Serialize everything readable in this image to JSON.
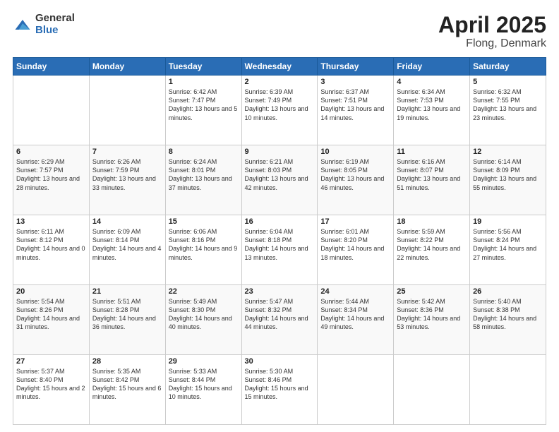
{
  "header": {
    "logo_general": "General",
    "logo_blue": "Blue",
    "title": "April 2025",
    "subtitle": "Flong, Denmark"
  },
  "days_of_week": [
    "Sunday",
    "Monday",
    "Tuesday",
    "Wednesday",
    "Thursday",
    "Friday",
    "Saturday"
  ],
  "weeks": [
    [
      {
        "day": "",
        "info": ""
      },
      {
        "day": "",
        "info": ""
      },
      {
        "day": "1",
        "info": "Sunrise: 6:42 AM\nSunset: 7:47 PM\nDaylight: 13 hours and 5 minutes."
      },
      {
        "day": "2",
        "info": "Sunrise: 6:39 AM\nSunset: 7:49 PM\nDaylight: 13 hours and 10 minutes."
      },
      {
        "day": "3",
        "info": "Sunrise: 6:37 AM\nSunset: 7:51 PM\nDaylight: 13 hours and 14 minutes."
      },
      {
        "day": "4",
        "info": "Sunrise: 6:34 AM\nSunset: 7:53 PM\nDaylight: 13 hours and 19 minutes."
      },
      {
        "day": "5",
        "info": "Sunrise: 6:32 AM\nSunset: 7:55 PM\nDaylight: 13 hours and 23 minutes."
      }
    ],
    [
      {
        "day": "6",
        "info": "Sunrise: 6:29 AM\nSunset: 7:57 PM\nDaylight: 13 hours and 28 minutes."
      },
      {
        "day": "7",
        "info": "Sunrise: 6:26 AM\nSunset: 7:59 PM\nDaylight: 13 hours and 33 minutes."
      },
      {
        "day": "8",
        "info": "Sunrise: 6:24 AM\nSunset: 8:01 PM\nDaylight: 13 hours and 37 minutes."
      },
      {
        "day": "9",
        "info": "Sunrise: 6:21 AM\nSunset: 8:03 PM\nDaylight: 13 hours and 42 minutes."
      },
      {
        "day": "10",
        "info": "Sunrise: 6:19 AM\nSunset: 8:05 PM\nDaylight: 13 hours and 46 minutes."
      },
      {
        "day": "11",
        "info": "Sunrise: 6:16 AM\nSunset: 8:07 PM\nDaylight: 13 hours and 51 minutes."
      },
      {
        "day": "12",
        "info": "Sunrise: 6:14 AM\nSunset: 8:09 PM\nDaylight: 13 hours and 55 minutes."
      }
    ],
    [
      {
        "day": "13",
        "info": "Sunrise: 6:11 AM\nSunset: 8:12 PM\nDaylight: 14 hours and 0 minutes."
      },
      {
        "day": "14",
        "info": "Sunrise: 6:09 AM\nSunset: 8:14 PM\nDaylight: 14 hours and 4 minutes."
      },
      {
        "day": "15",
        "info": "Sunrise: 6:06 AM\nSunset: 8:16 PM\nDaylight: 14 hours and 9 minutes."
      },
      {
        "day": "16",
        "info": "Sunrise: 6:04 AM\nSunset: 8:18 PM\nDaylight: 14 hours and 13 minutes."
      },
      {
        "day": "17",
        "info": "Sunrise: 6:01 AM\nSunset: 8:20 PM\nDaylight: 14 hours and 18 minutes."
      },
      {
        "day": "18",
        "info": "Sunrise: 5:59 AM\nSunset: 8:22 PM\nDaylight: 14 hours and 22 minutes."
      },
      {
        "day": "19",
        "info": "Sunrise: 5:56 AM\nSunset: 8:24 PM\nDaylight: 14 hours and 27 minutes."
      }
    ],
    [
      {
        "day": "20",
        "info": "Sunrise: 5:54 AM\nSunset: 8:26 PM\nDaylight: 14 hours and 31 minutes."
      },
      {
        "day": "21",
        "info": "Sunrise: 5:51 AM\nSunset: 8:28 PM\nDaylight: 14 hours and 36 minutes."
      },
      {
        "day": "22",
        "info": "Sunrise: 5:49 AM\nSunset: 8:30 PM\nDaylight: 14 hours and 40 minutes."
      },
      {
        "day": "23",
        "info": "Sunrise: 5:47 AM\nSunset: 8:32 PM\nDaylight: 14 hours and 44 minutes."
      },
      {
        "day": "24",
        "info": "Sunrise: 5:44 AM\nSunset: 8:34 PM\nDaylight: 14 hours and 49 minutes."
      },
      {
        "day": "25",
        "info": "Sunrise: 5:42 AM\nSunset: 8:36 PM\nDaylight: 14 hours and 53 minutes."
      },
      {
        "day": "26",
        "info": "Sunrise: 5:40 AM\nSunset: 8:38 PM\nDaylight: 14 hours and 58 minutes."
      }
    ],
    [
      {
        "day": "27",
        "info": "Sunrise: 5:37 AM\nSunset: 8:40 PM\nDaylight: 15 hours and 2 minutes."
      },
      {
        "day": "28",
        "info": "Sunrise: 5:35 AM\nSunset: 8:42 PM\nDaylight: 15 hours and 6 minutes."
      },
      {
        "day": "29",
        "info": "Sunrise: 5:33 AM\nSunset: 8:44 PM\nDaylight: 15 hours and 10 minutes."
      },
      {
        "day": "30",
        "info": "Sunrise: 5:30 AM\nSunset: 8:46 PM\nDaylight: 15 hours and 15 minutes."
      },
      {
        "day": "",
        "info": ""
      },
      {
        "day": "",
        "info": ""
      },
      {
        "day": "",
        "info": ""
      }
    ]
  ]
}
